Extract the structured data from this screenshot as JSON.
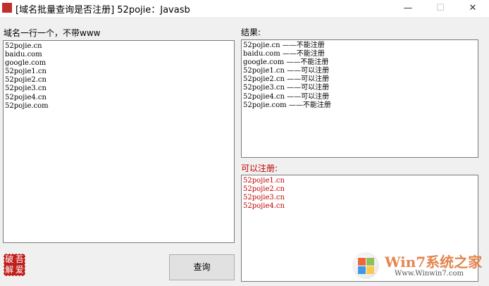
{
  "window": {
    "title": "[域名批量查询是否注册] 52pojie：Javasb",
    "minimize": "—",
    "maximize": "☐",
    "close": "✕"
  },
  "input": {
    "label": "域名一行一个，不带www",
    "lines": [
      "52pojie.cn",
      "baidu.com",
      "google.com",
      "52pojie1.cn",
      "52pojie2.cn",
      "52pojie3.cn",
      "52pojie4.cn",
      "52pojie.com"
    ]
  },
  "results": {
    "label": "结果:",
    "lines": [
      "52pojie.cn ——不能注册",
      "baidu.com ——不能注册",
      "google.com ——不能注册",
      "52pojie1.cn ——可以注册",
      "52pojie2.cn ——可以注册",
      "52pojie3.cn ——可以注册",
      "52pojie4.cn ——可以注册",
      "52pojie.com ——不能注册"
    ]
  },
  "available": {
    "label": "可以注册:",
    "lines": [
      "52pojie1.cn",
      "52pojie2.cn",
      "52pojie3.cn",
      "52pojie4.cn"
    ],
    "color": "#c00000"
  },
  "logo": {
    "chars": [
      "破",
      "吾",
      "解",
      "爱"
    ]
  },
  "query_button": "查询",
  "watermark": {
    "brand": "Win7系统之家",
    "url": "Www.Winwin7.com"
  }
}
